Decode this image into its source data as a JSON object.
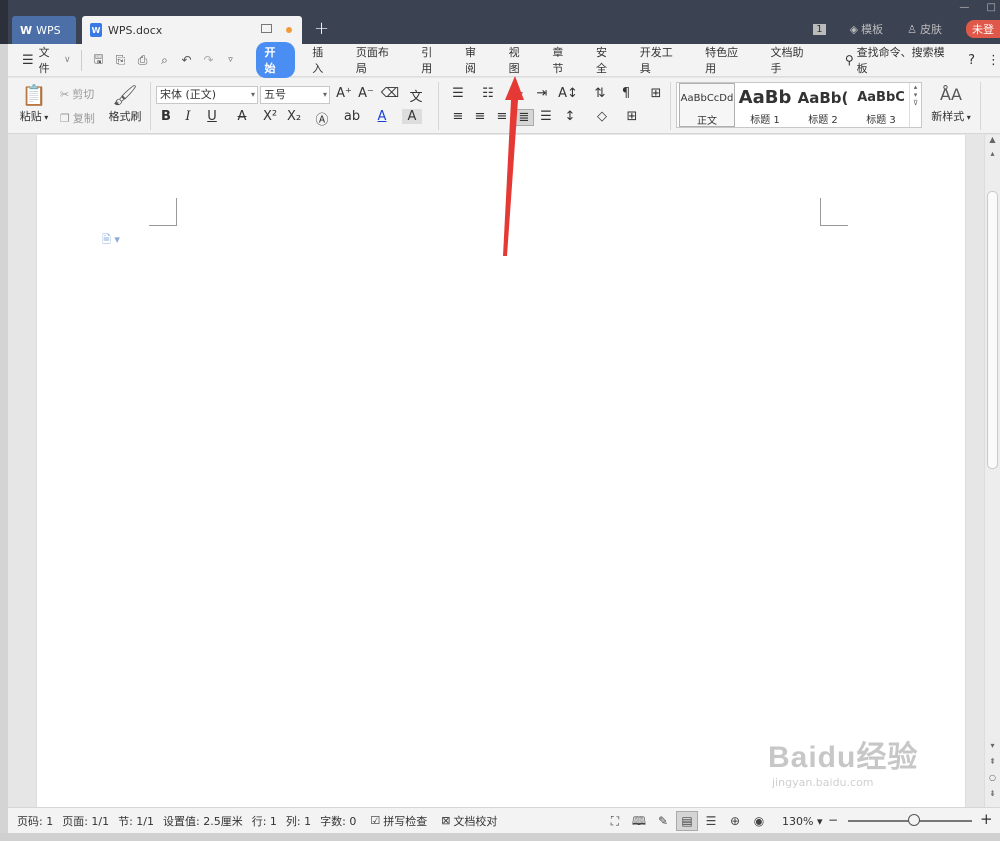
{
  "titlebar": {
    "home_tab": "WPS",
    "home_logo": "W",
    "doc_tab": "WPS.docx",
    "doc_icon": "W",
    "new_tab": "+",
    "badge_num": "1",
    "template_label": "模板",
    "skin_label": "皮肤",
    "login_label": "未登",
    "minimize": "—",
    "maximize": "□"
  },
  "menu": {
    "file": "文件",
    "tabs": [
      "开始",
      "插入",
      "页面布局",
      "引用",
      "审阅",
      "视图",
      "章节",
      "安全",
      "开发工具",
      "特色应用",
      "文档助手"
    ],
    "active_tab": "开始",
    "search": "查找命令、搜索模板",
    "help": "?",
    "more": "⋮"
  },
  "ribbon": {
    "paste": "粘贴",
    "cut": "剪切",
    "copy": "复制",
    "format_painter": "格式刷",
    "font_name": "宋体 (正文)",
    "font_size": "五号",
    "styles": [
      {
        "sample": "AaBbCcDd",
        "name": "正文"
      },
      {
        "sample": "AaBb",
        "name": "标题 1"
      },
      {
        "sample": "AaBb(",
        "name": "标题 2"
      },
      {
        "sample": "AaBbC",
        "name": "标题 3"
      }
    ],
    "new_style": "新样式"
  },
  "statusbar": {
    "page_num": "页码: 1",
    "pages": "页面: 1/1",
    "section": "节: 1/1",
    "setting": "设置值: 2.5厘米",
    "row": "行: 1",
    "col": "列: 1",
    "words": "字数: 0",
    "spell": "拼写检查",
    "proof": "文档校对",
    "zoom": "130%"
  },
  "watermark": {
    "brand": "Baidu经验",
    "url": "jingyan.baidu.com"
  },
  "colors": {
    "accent": "#4a8ef3",
    "titlebar": "#3b4252",
    "arrow": "#e53935"
  }
}
